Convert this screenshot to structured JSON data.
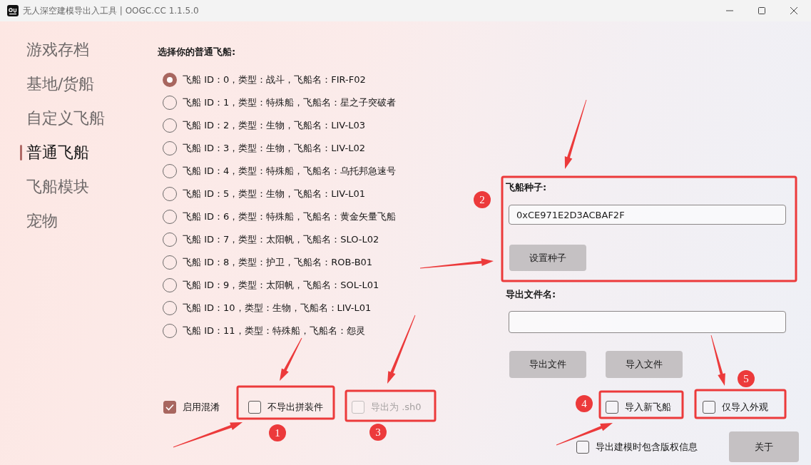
{
  "window": {
    "title": "无人深空建模导出入工具 | OOGC.CC 1.1.5.0"
  },
  "sidebar": {
    "items": [
      {
        "label": "游戏存档",
        "selected": false
      },
      {
        "label": "基地/货船",
        "selected": false
      },
      {
        "label": "自定义飞船",
        "selected": false
      },
      {
        "label": "普通飞船",
        "selected": true
      },
      {
        "label": "飞船模块",
        "selected": false
      },
      {
        "label": "宠物",
        "selected": false
      }
    ]
  },
  "ship_list": {
    "heading": "选择你的普通飞船:",
    "ships": [
      {
        "label": "飞船 ID：0，类型：战斗，飞船名：FIR-F02",
        "selected": true
      },
      {
        "label": "飞船 ID：1，类型：特殊船，飞船名：星之子突破者",
        "selected": false
      },
      {
        "label": "飞船 ID：2，类型：生物，飞船名：LIV-L03",
        "selected": false
      },
      {
        "label": "飞船 ID：3，类型：生物，飞船名：LIV-L02",
        "selected": false
      },
      {
        "label": "飞船 ID：4，类型：特殊船，飞船名：乌托邦急速号",
        "selected": false
      },
      {
        "label": "飞船 ID：5，类型：生物，飞船名：LIV-L01",
        "selected": false
      },
      {
        "label": "飞船 ID：6，类型：特殊船，飞船名：黄金矢量飞船",
        "selected": false
      },
      {
        "label": "飞船 ID：7，类型：太阳帆，飞船名：SLO-L02",
        "selected": false
      },
      {
        "label": "飞船 ID：8，类型：护卫，飞船名：ROB-B01",
        "selected": false
      },
      {
        "label": "飞船 ID：9，类型：太阳帆，飞船名：SOL-L01",
        "selected": false
      },
      {
        "label": "飞船 ID：10，类型：生物，飞船名：LIV-L01",
        "selected": false
      },
      {
        "label": "飞船 ID：11，类型：特殊船，飞船名：怨灵",
        "selected": false
      }
    ]
  },
  "seed": {
    "label": "飞船种子:",
    "value": "0xCE971E2D3ACBAF2F",
    "button": "设置种子"
  },
  "export": {
    "label": "导出文件名:",
    "buttons": [
      "导出文件",
      "导入文件"
    ]
  },
  "left_options": [
    {
      "label": "启用混淆",
      "checked": true,
      "disabled": false
    },
    {
      "label": "不导出拼装件",
      "checked": false,
      "disabled": false
    },
    {
      "label": "导出为 .sh0",
      "checked": false,
      "disabled": true
    }
  ],
  "right_options": [
    {
      "label": "导入新飞船",
      "checked": false,
      "disabled": false
    },
    {
      "label": "仅导入外观",
      "checked": false,
      "disabled": false
    }
  ],
  "footer": {
    "options": [
      {
        "label": "导出建模时包含版权信息",
        "checked": false,
        "disabled": false
      }
    ],
    "button": "关于"
  },
  "callouts": [
    {
      "number": "1"
    },
    {
      "number": "2"
    },
    {
      "number": "3"
    },
    {
      "number": "4"
    },
    {
      "number": "5"
    }
  ]
}
